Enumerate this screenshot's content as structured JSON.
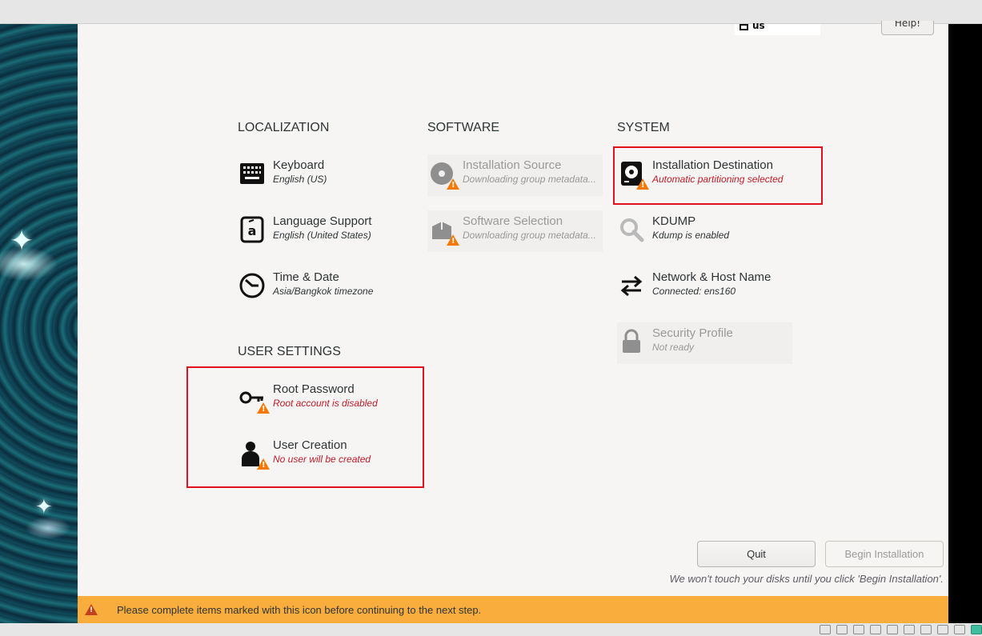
{
  "header": {
    "keyboard_layout": "us",
    "help_label": "Help!"
  },
  "sections": {
    "localization": "LOCALIZATION",
    "software": "SOFTWARE",
    "system": "SYSTEM",
    "user_settings": "USER SETTINGS"
  },
  "spokes": {
    "keyboard": {
      "title": "Keyboard",
      "status": "English (US)",
      "icon": "keyboard-icon"
    },
    "language": {
      "title": "Language Support",
      "status": "English (United States)",
      "icon": "language-icon"
    },
    "time": {
      "title": "Time & Date",
      "status": "Asia/Bangkok timezone",
      "icon": "clock-icon"
    },
    "install_source": {
      "title": "Installation Source",
      "status": "Downloading group metadata...",
      "icon": "disc-icon"
    },
    "software_selection": {
      "title": "Software Selection",
      "status": "Downloading group metadata...",
      "icon": "package-icon"
    },
    "install_dest": {
      "title": "Installation Destination",
      "status": "Automatic partitioning selected",
      "icon": "harddisk-icon"
    },
    "kdump": {
      "title": "KDUMP",
      "status": "Kdump is enabled",
      "icon": "search-icon"
    },
    "network": {
      "title": "Network & Host Name",
      "status": "Connected: ens160",
      "icon": "network-arrows-icon"
    },
    "security": {
      "title": "Security Profile",
      "status": "Not ready",
      "icon": "lock-icon"
    },
    "root_password": {
      "title": "Root Password",
      "status": "Root account is disabled",
      "icon": "key-icon"
    },
    "user_creation": {
      "title": "User Creation",
      "status": "No user will be created",
      "icon": "user-icon"
    }
  },
  "footer": {
    "quit_label": "Quit",
    "begin_label": "Begin Installation",
    "note": "We won't touch your disks until you click 'Begin Installation'.",
    "warning": "Please complete items marked with this icon before continuing to the next step."
  },
  "colors": {
    "warning_bar": "#f8ad3c",
    "warning_icon": "#f57900",
    "error_text": "#c01c28",
    "highlight": "#e0121b"
  }
}
